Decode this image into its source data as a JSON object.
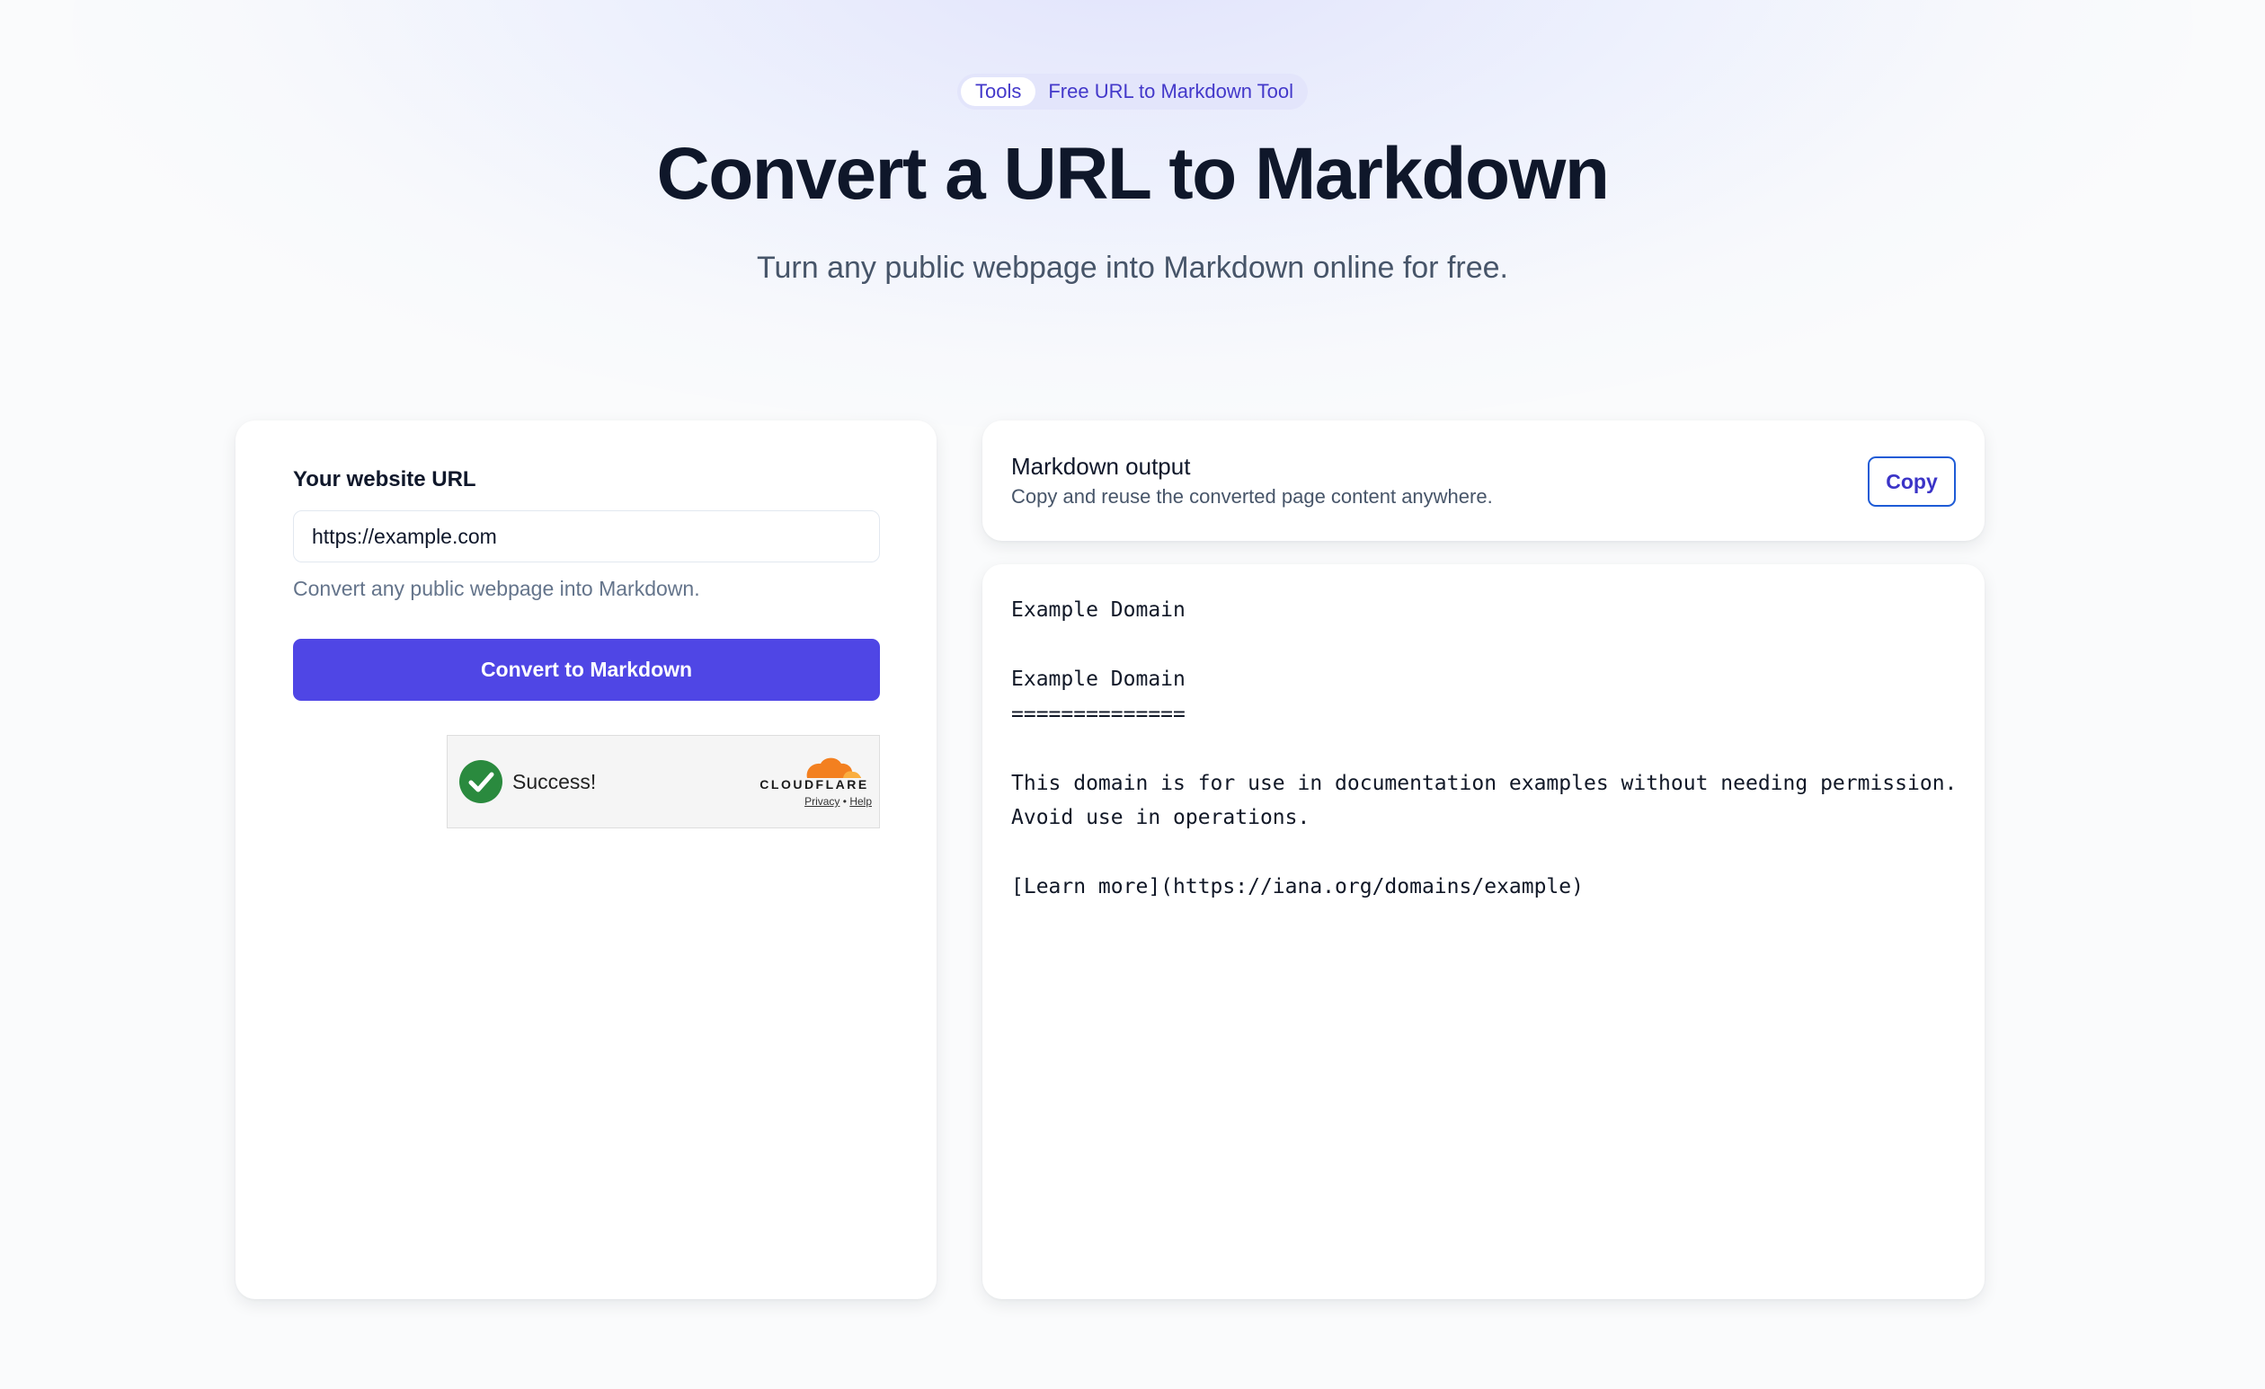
{
  "breadcrumb": {
    "parent_label": "Tools",
    "current_label": "Free URL to Markdown Tool"
  },
  "hero": {
    "title": "Convert a URL to Markdown",
    "subtitle": "Turn any public webpage into Markdown online for free."
  },
  "form": {
    "url_label": "Your website URL",
    "url_value": "https://example.com",
    "url_help": "Convert any public webpage into Markdown.",
    "convert_button_label": "Convert to Markdown"
  },
  "captcha": {
    "status_text": "Success!",
    "status_icon": "check-circle-icon",
    "brand": "CLOUDFLARE",
    "privacy_link": "Privacy",
    "separator": "•",
    "help_link": "Help"
  },
  "output": {
    "title": "Markdown output",
    "description": "Copy and reuse the converted page content anywhere.",
    "copy_button_label": "Copy",
    "content": "Example Domain\n\nExample Domain\n==============\n\nThis domain is for use in documentation examples without needing permission.\nAvoid use in operations.\n\n[Learn more](https://iana.org/domains/example)"
  },
  "colors": {
    "accent": "#4f46e5",
    "breadcrumb_text": "#4338ca",
    "success_green": "#2a8a3e",
    "cloudflare_orange": "#f38020"
  }
}
